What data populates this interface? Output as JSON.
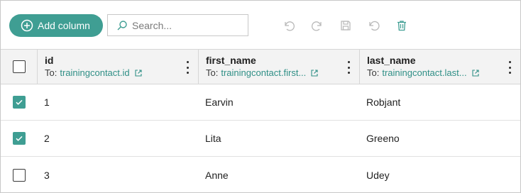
{
  "toolbar": {
    "add_column_label": "Add column",
    "search_placeholder": "Search...",
    "accent_color": "#3f9e93",
    "icons": [
      "plus-circle-icon",
      "search-icon",
      "undo-icon",
      "redo-icon",
      "save-icon",
      "refresh-icon",
      "delete-icon"
    ]
  },
  "table": {
    "columns": [
      {
        "name": "id",
        "to_label": "To:",
        "target": "trainingcontact.id"
      },
      {
        "name": "first_name",
        "to_label": "To:",
        "target": "trainingcontact.first..."
      },
      {
        "name": "last_name",
        "to_label": "To:",
        "target": "trainingcontact.last..."
      }
    ],
    "rows": [
      {
        "checked": true,
        "cells": [
          "1",
          "Earvin",
          "Robjant"
        ]
      },
      {
        "checked": true,
        "cells": [
          "2",
          "Lita",
          "Greeno"
        ]
      },
      {
        "checked": false,
        "cells": [
          "3",
          "Anne",
          "Udey"
        ]
      }
    ]
  }
}
